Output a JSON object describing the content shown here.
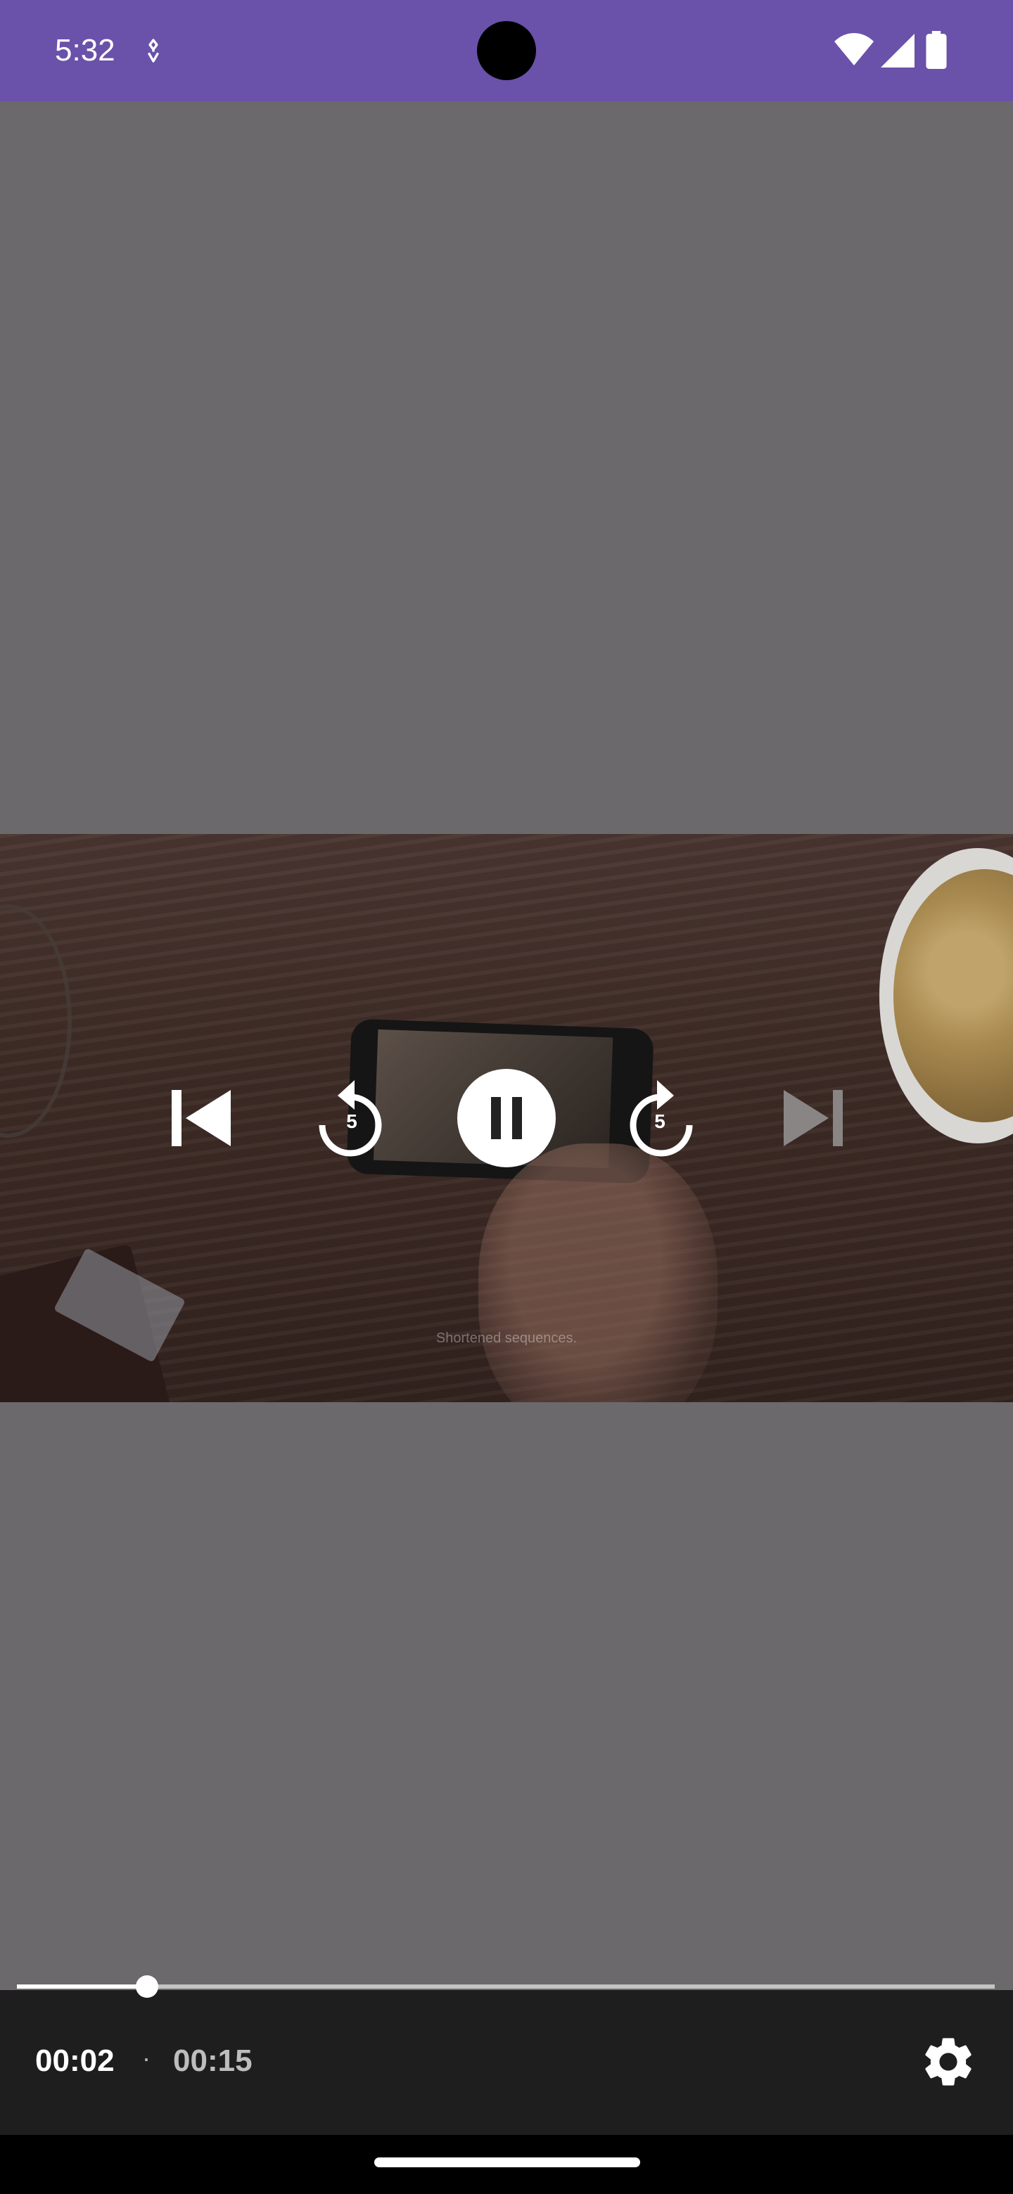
{
  "status_bar": {
    "time": "5:32",
    "background": "#6A51A9",
    "icons": [
      "notification-icon",
      "wifi-icon",
      "signal-icon",
      "battery-icon"
    ]
  },
  "player": {
    "video_caption": "Shortened sequences.",
    "controls": {
      "previous": "skip-previous-icon",
      "rewind": "replay-5-icon",
      "rewind_seconds": "5",
      "play_pause": "pause-icon",
      "forward": "forward-5-icon",
      "forward_seconds": "5",
      "next": "skip-next-icon"
    },
    "position": {
      "current": "00:02",
      "separator": "·",
      "duration": "00:15",
      "progress_fraction": 0.133
    },
    "settings_icon": "gear-icon"
  },
  "colors": {
    "backdrop": "#6B696B",
    "control_strip": "#1E1E1E",
    "accent": "#6A51A9"
  }
}
